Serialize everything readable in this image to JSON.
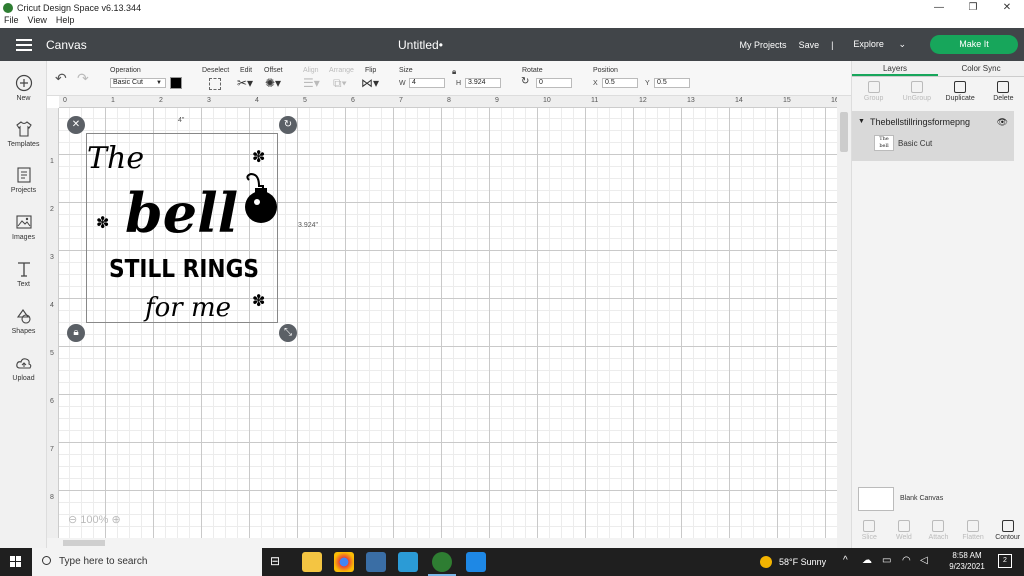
{
  "window": {
    "title": "Cricut Design Space  v6.13.344",
    "min": "—",
    "max": "❐",
    "close": "✕"
  },
  "menu": [
    "File",
    "View",
    "Help"
  ],
  "header": {
    "section": "Canvas",
    "doc_title": "Untitled•",
    "my_projects": "My Projects",
    "save": "Save",
    "separator": "|",
    "explore": "Explore",
    "make_it": "Make It"
  },
  "sidebar": [
    {
      "label": "New",
      "icon": "plus-circle-icon"
    },
    {
      "label": "Templates",
      "icon": "tshirt-icon"
    },
    {
      "label": "Projects",
      "icon": "projects-icon"
    },
    {
      "label": "Images",
      "icon": "image-icon"
    },
    {
      "label": "Text",
      "icon": "text-icon"
    },
    {
      "label": "Shapes",
      "icon": "shapes-icon"
    },
    {
      "label": "Upload",
      "icon": "upload-cloud-icon"
    }
  ],
  "editbar": {
    "operation_label": "Operation",
    "operation_value": "Basic Cut",
    "deselect": "Deselect",
    "edit": "Edit",
    "offset": "Offset",
    "align": "Align",
    "arrange": "Arrange",
    "flip": "Flip",
    "size_label": "Size",
    "w_label": "W",
    "w_value": "4",
    "h_label": "H",
    "h_value": "3.924",
    "rotate_label": "Rotate",
    "rotate_value": "0",
    "position_label": "Position",
    "x_label": "X",
    "x_value": "0.5",
    "y_label": "Y",
    "y_value": "0.5"
  },
  "ruler": {
    "top": [
      "0",
      "1",
      "2",
      "3",
      "4",
      "5",
      "6",
      "7",
      "8",
      "9",
      "10",
      "11",
      "12",
      "13",
      "14",
      "15",
      "16"
    ],
    "left": [
      "1",
      "2",
      "3",
      "4",
      "5",
      "6",
      "7",
      "8",
      "9"
    ]
  },
  "design": {
    "width_label": "4\"",
    "height_label": "3.924\"",
    "line1": "The",
    "line2": "bell",
    "line3": "STILL RINGS",
    "line4": "for me"
  },
  "zoom": "100%",
  "right_panel": {
    "tabs": [
      "Layers",
      "Color Sync"
    ],
    "actions": [
      "Group",
      "UnGroup",
      "Duplicate",
      "Delete"
    ],
    "layer_name": "Thebellstillringsformepng",
    "layer_sub": "Basic Cut",
    "layer_thumb": "The bell",
    "blank_canvas": "Blank Canvas",
    "bottom_actions": [
      "Slice",
      "Weld",
      "Attach",
      "Flatten",
      "Contour"
    ]
  },
  "taskbar": {
    "search_placeholder": "Type here to search",
    "weather": "58°F  Sunny",
    "time": "8:58 AM",
    "date": "9/23/2021",
    "notifications": "2"
  }
}
